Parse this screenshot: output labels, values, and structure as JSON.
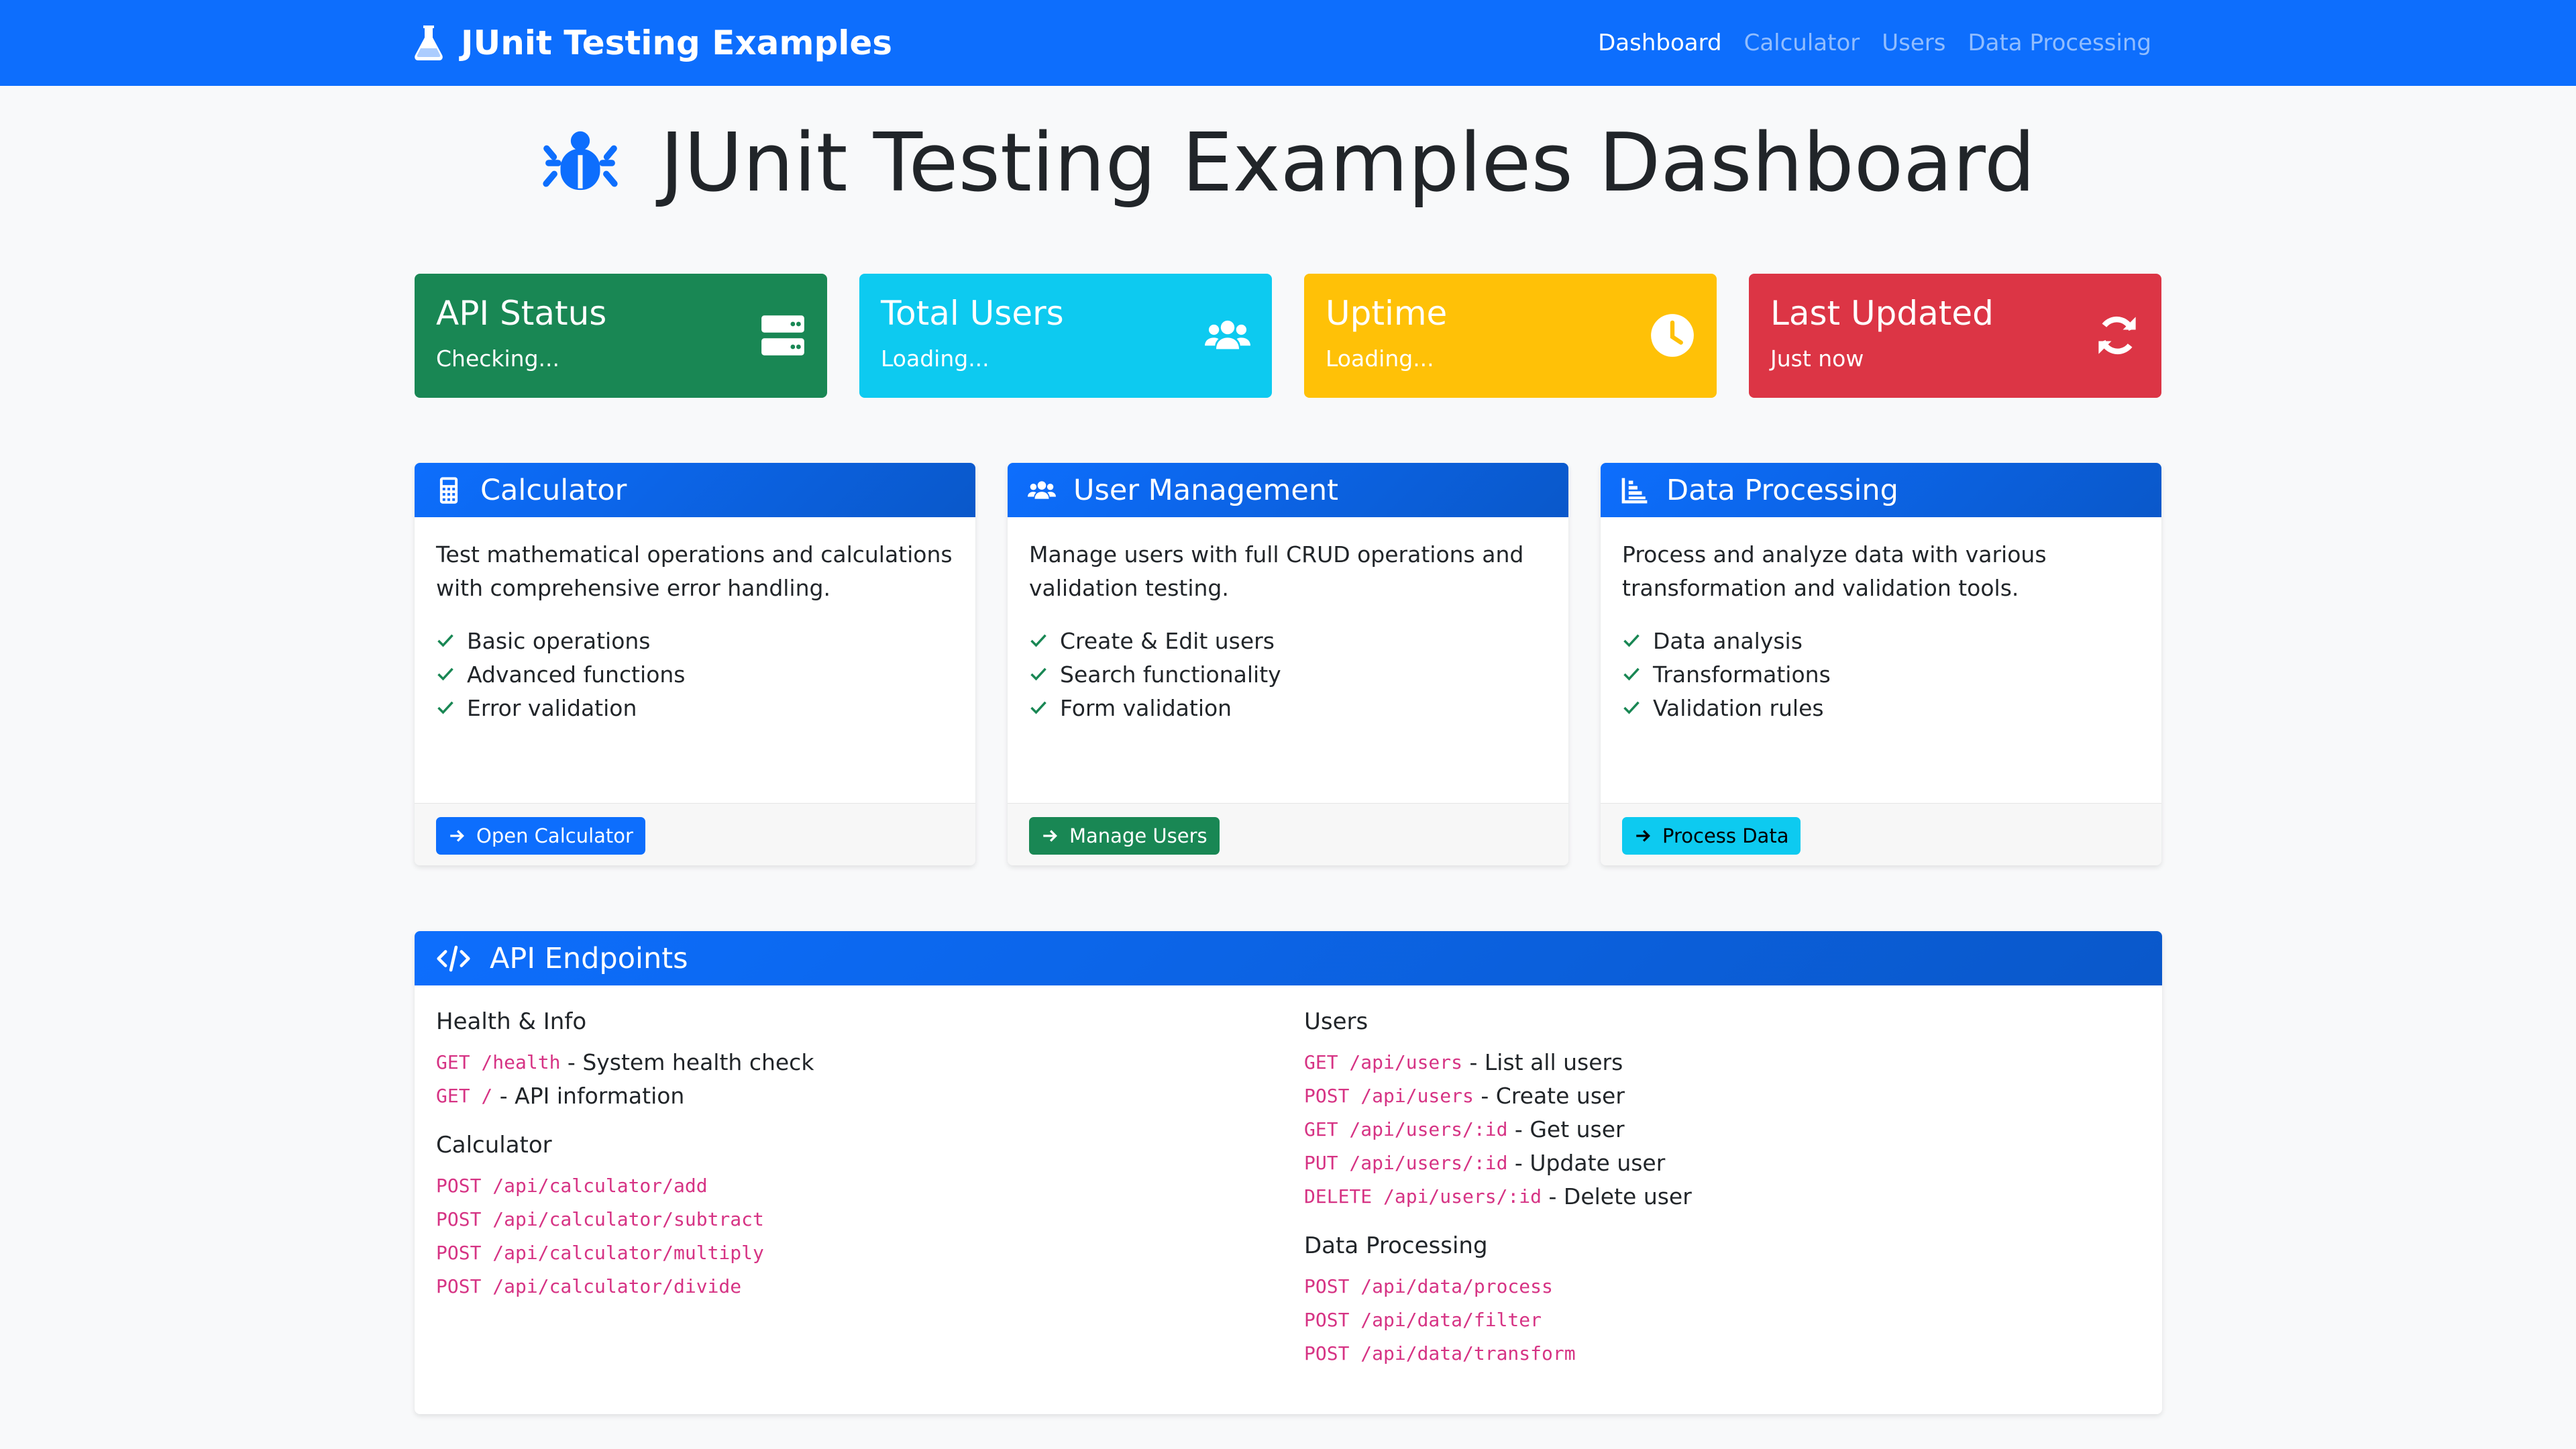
{
  "nav": {
    "brand": "JUnit Testing Examples",
    "links": [
      "Dashboard",
      "Calculator",
      "Users",
      "Data Processing"
    ]
  },
  "page_title": "JUnit Testing Examples Dashboard",
  "stats": [
    {
      "title": "API Status",
      "value": "Checking...",
      "icon": "server-icon",
      "color": "#198754"
    },
    {
      "title": "Total Users",
      "value": "Loading...",
      "icon": "users-icon",
      "color": "#0dcaf0"
    },
    {
      "title": "Uptime",
      "value": "Loading...",
      "icon": "clock-icon",
      "color": "#ffc107"
    },
    {
      "title": "Last Updated",
      "value": "Just now",
      "icon": "refresh-icon",
      "color": "#dc3545"
    }
  ],
  "cards": [
    {
      "title": "Calculator",
      "icon": "calculator-icon",
      "description": "Test mathematical operations and calculations with comprehensive error handling.",
      "features": [
        "Basic operations",
        "Advanced functions",
        "Error validation"
      ],
      "button": "Open Calculator"
    },
    {
      "title": "User Management",
      "icon": "users-icon",
      "description": "Manage users with full CRUD operations and validation testing.",
      "features": [
        "Create & Edit users",
        "Search functionality",
        "Form validation"
      ],
      "button": "Manage Users"
    },
    {
      "title": "Data Processing",
      "icon": "chart-icon",
      "description": "Process and analyze data with various transformation and validation tools.",
      "features": [
        "Data analysis",
        "Transformations",
        "Validation rules"
      ],
      "button": "Process Data"
    }
  ],
  "api": {
    "title": "API Endpoints",
    "health": {
      "title": "Health & Info",
      "endpoints": [
        {
          "code": "GET /health",
          "desc": " - System health check"
        },
        {
          "code": "GET /",
          "desc": " - API information"
        }
      ]
    },
    "calculator": {
      "title": "Calculator",
      "endpoints": [
        {
          "code": "POST /api/calculator/add"
        },
        {
          "code": "POST /api/calculator/subtract"
        },
        {
          "code": "POST /api/calculator/multiply"
        },
        {
          "code": "POST /api/calculator/divide"
        }
      ]
    },
    "users": {
      "title": "Users",
      "endpoints": [
        {
          "code": "GET /api/users",
          "desc": " - List all users"
        },
        {
          "code": "POST /api/users",
          "desc": " - Create user"
        },
        {
          "code": "GET /api/users/:id",
          "desc": " - Get user"
        },
        {
          "code": "PUT /api/users/:id",
          "desc": " - Update user"
        },
        {
          "code": "DELETE /api/users/:id",
          "desc": " - Delete user"
        }
      ]
    },
    "data": {
      "title": "Data Processing",
      "endpoints": [
        {
          "code": "POST /api/data/process"
        },
        {
          "code": "POST /api/data/filter"
        },
        {
          "code": "POST /api/data/transform"
        }
      ]
    }
  }
}
